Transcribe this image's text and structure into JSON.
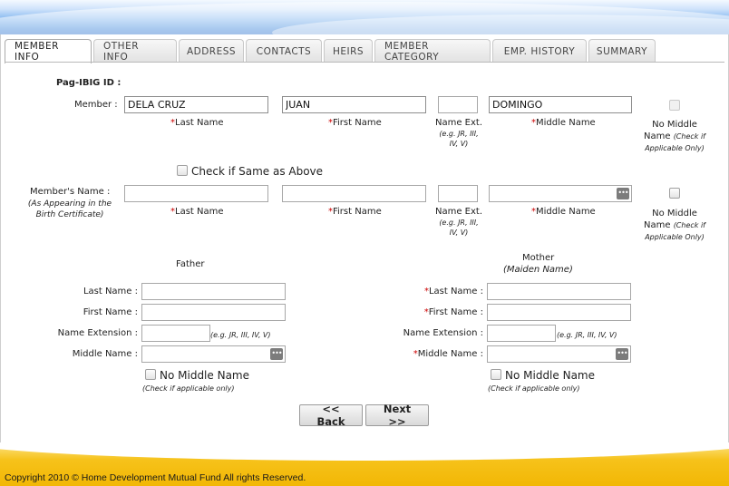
{
  "tabs": [
    {
      "label": "MEMBER INFO",
      "active": true
    },
    {
      "label": "OTHER INFO",
      "active": false
    },
    {
      "label": "ADDRESS",
      "active": false
    },
    {
      "label": "CONTACTS",
      "active": false
    },
    {
      "label": "HEIRS",
      "active": false
    },
    {
      "label": "MEMBER CATEGORY",
      "active": false
    },
    {
      "label": "EMP. HISTORY",
      "active": false
    },
    {
      "label": "SUMMARY",
      "active": false
    }
  ],
  "pagibig_id_label": "Pag-IBIG ID :",
  "member": {
    "label": "Member :",
    "last_name": "DELA CRUZ",
    "first_name": "JUAN",
    "name_ext": "",
    "middle_name": "DOMINGO"
  },
  "captions": {
    "last_name": "Last Name",
    "first_name": "First Name",
    "name_ext": "Name Ext.",
    "name_ext_hint": "(e.g. JR, III, IV, V)",
    "middle_name": "Middle Name",
    "no_middle": "No Middle Name",
    "no_middle_hint": "(Check if Applicable Only)",
    "required_mark": "*"
  },
  "same_as_above_label": "Check if Same as Above",
  "members_name": {
    "label": "Member's Name :",
    "hint": "(As Appearing in the Birth Certificate)",
    "last_name": "",
    "first_name": "",
    "name_ext": "",
    "middle_name": ""
  },
  "father": {
    "title": "Father",
    "last_name_label": "Last Name :",
    "first_name_label": "First Name :",
    "ext_label": "Name Extension :",
    "ext_hint": "(e.g. JR, III, IV, V)",
    "middle_label": "Middle Name :",
    "no_middle_label": "No Middle Name",
    "no_middle_hint": "(Check if applicable only)"
  },
  "mother": {
    "title": "Mother",
    "subtitle": "(Maiden Name)",
    "last_name_label": "Last Name :",
    "first_name_label": "First Name :",
    "ext_label": "Name Extension :",
    "ext_hint": "(e.g. JR, III, IV, V)",
    "middle_label": "Middle Name :",
    "no_middle_label": "No Middle Name",
    "no_middle_hint": "(Check if applicable only)"
  },
  "buttons": {
    "back": "<< Back",
    "next": "Next >>"
  },
  "footer": {
    "copyright": "Copyright 2010 © Home Development Mutual Fund All rights Reserved."
  },
  "colors": {
    "required": "#cc0000",
    "header_blue": "#3f86db",
    "footer_gold": "#f2b705"
  }
}
